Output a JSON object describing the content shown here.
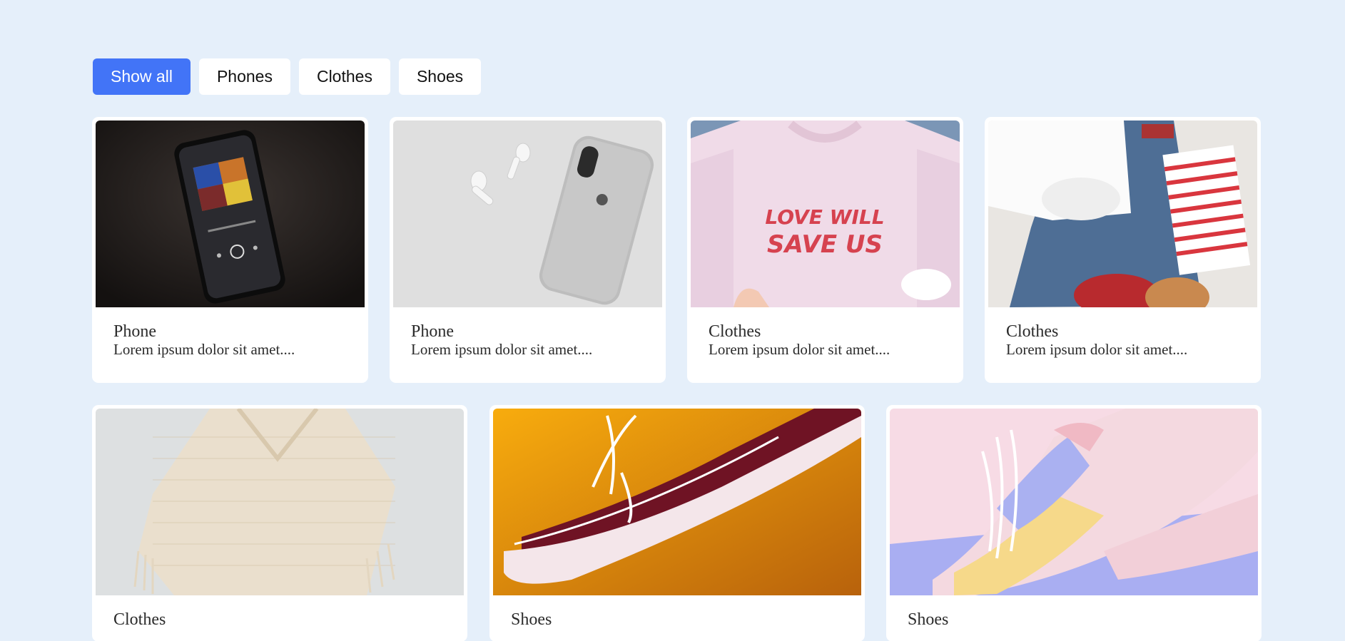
{
  "filters": [
    {
      "label": "Show all",
      "active": true
    },
    {
      "label": "Phones"
    },
    {
      "label": "Clothes"
    },
    {
      "label": "Shoes"
    }
  ],
  "cards": [
    {
      "title": "Phone",
      "description": "Lorem ipsum dolor sit amet....",
      "image": "phone-music-player-image"
    },
    {
      "title": "Phone",
      "description": "Lorem ipsum dolor sit amet....",
      "image": "phone-airpods-image"
    },
    {
      "title": "Clothes",
      "description": "Lorem ipsum dolor sit amet....",
      "image": "pink-tshirt-image",
      "image_text_1": "LOVE WILL",
      "image_text_2": "SAVE US"
    },
    {
      "title": "Clothes",
      "description": "Lorem ipsum dolor sit amet....",
      "image": "folded-clothes-image"
    },
    {
      "title": "Clothes",
      "description": "",
      "image": "knit-top-image"
    },
    {
      "title": "Shoes",
      "description": "",
      "image": "red-sneaker-image"
    },
    {
      "title": "Shoes",
      "description": "",
      "image": "pastel-sneakers-image"
    }
  ],
  "colors": {
    "page_background": "#e5effa",
    "accent": "#4274f7"
  }
}
